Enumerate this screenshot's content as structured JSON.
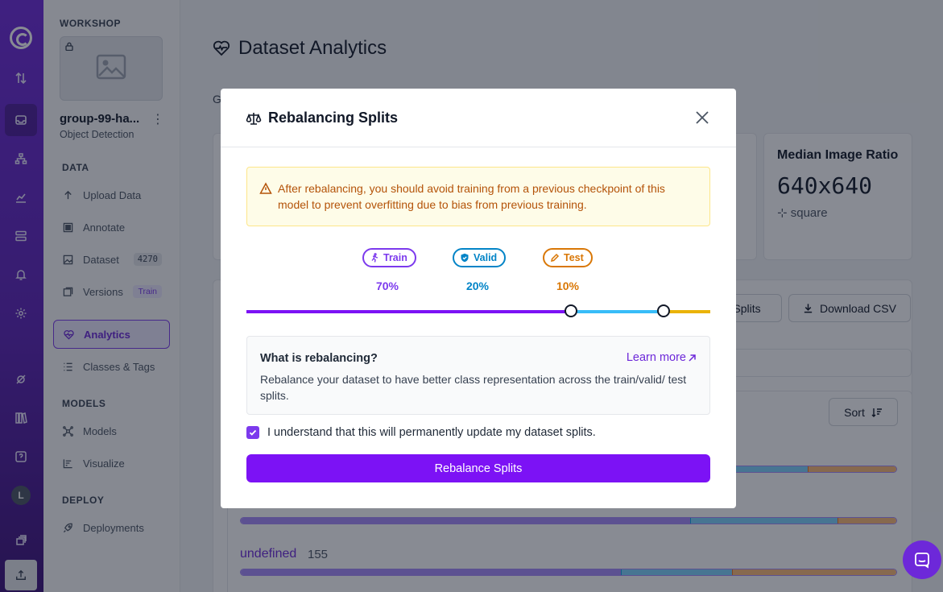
{
  "sidebar": {
    "workshop_label": "WORKSHOP",
    "project_name": "group-99-ha...",
    "project_type": "Object Detection",
    "sections": {
      "data": "DATA",
      "models": "MODELS",
      "deploy": "DEPLOY"
    },
    "items": {
      "upload": "Upload Data",
      "annotate": "Annotate",
      "dataset": "Dataset",
      "dataset_count": "4270",
      "versions": "Versions",
      "versions_badge": "Train",
      "analytics": "Analytics",
      "classes": "Classes & Tags",
      "models": "Models",
      "visualize": "Visualize",
      "deployments": "Deployments"
    },
    "avatar_initial": "L"
  },
  "main": {
    "title": "Dataset Analytics",
    "peek_letter": "G",
    "median_card": {
      "title": "Median Image Ratio",
      "value": "640x640",
      "sub": "square"
    },
    "rebalance_button": "Splits",
    "download_button": "Download CSV",
    "sort_button": "Sort",
    "class_row": {
      "name": "undefined",
      "count": "155",
      "split": {
        "train": 0.58,
        "valid": 0.17,
        "test": 0.25
      }
    }
  },
  "modal": {
    "title": "Rebalancing Splits",
    "alert": "After rebalancing, you should avoid training from a previous checkpoint of this model to prevent overfitting due to bias from previous training.",
    "splits": [
      {
        "label": "Train",
        "pct": "70%",
        "value": 0.7,
        "color": "#7c3aed",
        "bar": "#7c12f5"
      },
      {
        "label": "Valid",
        "pct": "20%",
        "value": 0.2,
        "color": "#0284c7",
        "bar": "#38bdf8"
      },
      {
        "label": "Test",
        "pct": "10%",
        "value": 0.1,
        "color": "#d97706",
        "bar": "#eab308"
      }
    ],
    "info_title": "What is rebalancing?",
    "learn_more": "Learn more",
    "info_body": "Rebalance your dataset to have better class representation across the train/valid/ test splits.",
    "confirm_label": "I understand that this will permanently update my dataset splits.",
    "confirm_checked": true,
    "primary_button": "Rebalance Splits"
  }
}
